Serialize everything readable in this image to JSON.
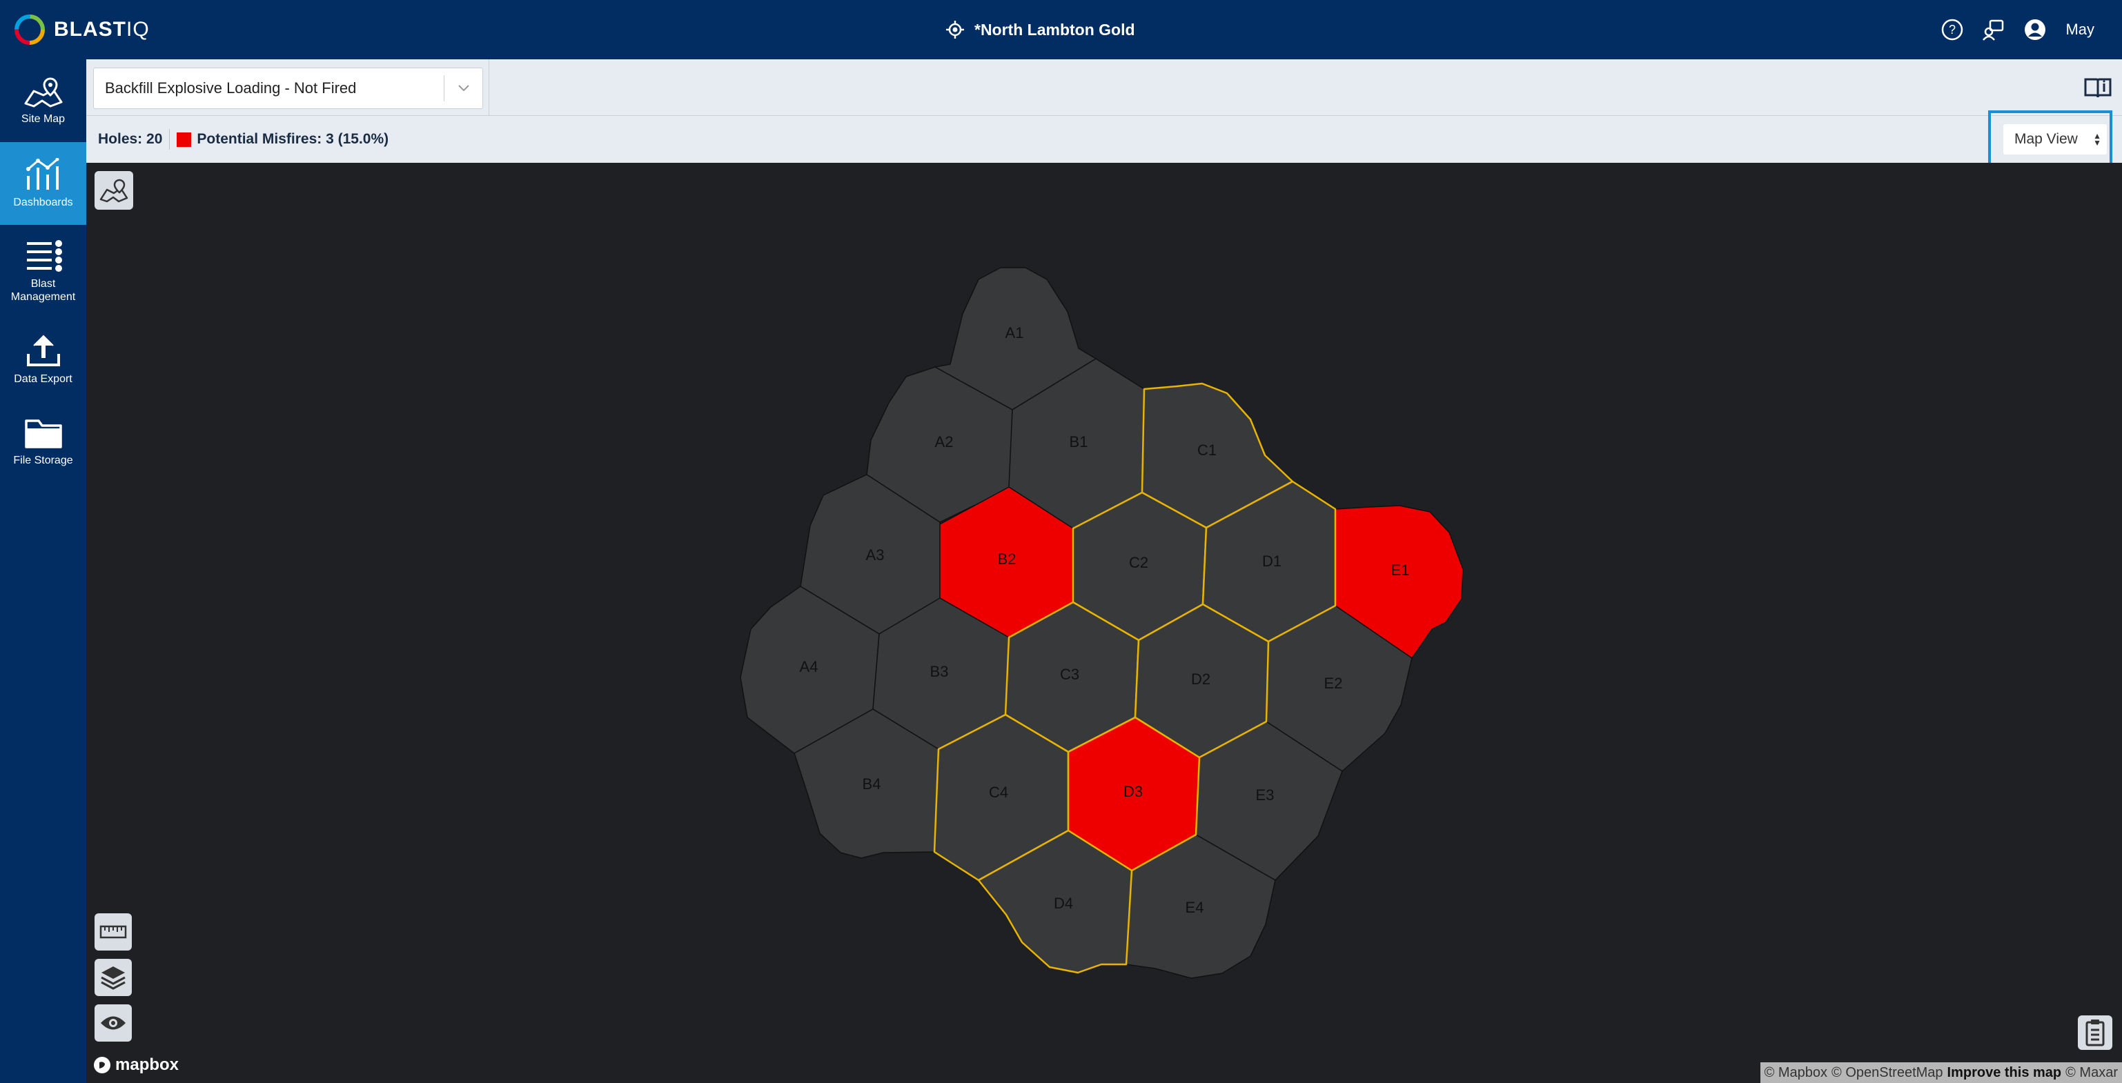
{
  "app": {
    "name_bold": "BLAST",
    "name_thin": "IQ"
  },
  "header": {
    "site": "*North Lambton Gold",
    "user": "May"
  },
  "sidebar": {
    "items": [
      {
        "label": "Site Map"
      },
      {
        "label": "Dashboards"
      },
      {
        "label": "Blast\nManagement"
      },
      {
        "label": "Data Export"
      },
      {
        "label": "File Storage"
      }
    ]
  },
  "toolbar": {
    "dashboard_select": "Backfill Explosive Loading - Not Fired"
  },
  "infobar": {
    "holes": "Holes: 20",
    "misfires": "Potential Misfires: 3 (15.0%)",
    "misfire_color": "#ee0000",
    "view_select": "Map View"
  },
  "map": {
    "cells": [
      {
        "id": "A1",
        "misfire": false,
        "highlight": false
      },
      {
        "id": "A2",
        "misfire": false,
        "highlight": false
      },
      {
        "id": "A3",
        "misfire": false,
        "highlight": false
      },
      {
        "id": "A4",
        "misfire": false,
        "highlight": false
      },
      {
        "id": "B1",
        "misfire": false,
        "highlight": false
      },
      {
        "id": "B2",
        "misfire": true,
        "highlight": false
      },
      {
        "id": "B3",
        "misfire": false,
        "highlight": false
      },
      {
        "id": "B4",
        "misfire": false,
        "highlight": false
      },
      {
        "id": "C1",
        "misfire": false,
        "highlight": true
      },
      {
        "id": "C2",
        "misfire": false,
        "highlight": true
      },
      {
        "id": "C3",
        "misfire": false,
        "highlight": true
      },
      {
        "id": "C4",
        "misfire": false,
        "highlight": true
      },
      {
        "id": "D1",
        "misfire": false,
        "highlight": true
      },
      {
        "id": "D2",
        "misfire": false,
        "highlight": true
      },
      {
        "id": "D3",
        "misfire": true,
        "highlight": true
      },
      {
        "id": "D4",
        "misfire": false,
        "highlight": true
      },
      {
        "id": "E1",
        "misfire": true,
        "highlight": false
      },
      {
        "id": "E2",
        "misfire": false,
        "highlight": false
      },
      {
        "id": "E3",
        "misfire": false,
        "highlight": false
      },
      {
        "id": "E4",
        "misfire": false,
        "highlight": false
      }
    ],
    "colors": {
      "cell": "#38393b",
      "misfire": "#ee0000",
      "highlight_border": "#e8b400",
      "border": "#111111"
    },
    "mapbox_logo": "mapbox",
    "attribution": {
      "mapbox": "© Mapbox",
      "osm": "© OpenStreetMap",
      "improve": "Improve this map",
      "maxar": "© Maxar"
    }
  }
}
